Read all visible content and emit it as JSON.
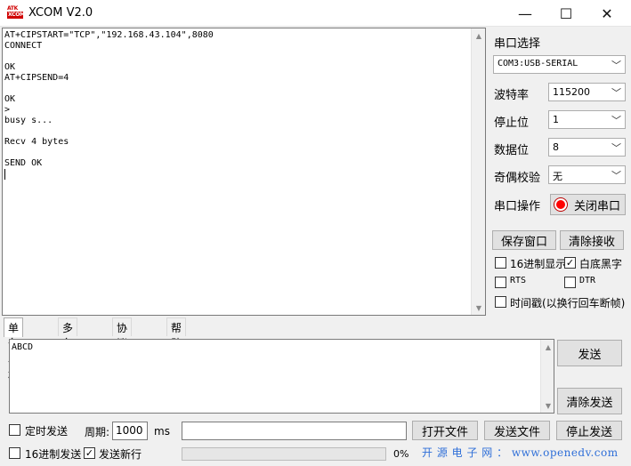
{
  "window": {
    "logo_top": "ATK",
    "logo_bottom": "XCOM",
    "title": "XCOM V2.0",
    "minimize": "—",
    "maximize": "☐",
    "close": "✕"
  },
  "receive": {
    "lines": [
      "AT+CIPSTART=\"TCP\",\"192.168.43.104\",8080",
      "CONNECT",
      "",
      "OK",
      "AT+CIPSEND=4",
      "",
      "OK",
      ">",
      "busy s...",
      "",
      "Recv 4 bytes",
      "",
      "SEND OK"
    ]
  },
  "serial": {
    "port_label": "串口选择",
    "port_value": "COM3:USB-SERIAL",
    "baud_label": "波特率",
    "baud_value": "115200",
    "stop_label": "停止位",
    "stop_value": "1",
    "data_label": "数据位",
    "data_value": "8",
    "parity_label": "奇偶校验",
    "parity_value": "无",
    "op_label": "串口操作",
    "close_port_button": "关闭串口",
    "port_open_color": "#ff0000"
  },
  "recv_options": {
    "save_window": "保存窗口",
    "clear_receive": "清除接收",
    "hex_display": "16进制显示",
    "hex_display_checked": false,
    "white_bg_black_text": "白底黑字",
    "white_bg_checked": true,
    "rts": "RTS",
    "rts_checked": false,
    "dtr": "DTR",
    "dtr_checked": false,
    "timestamp": "时间戳(以换行回车断帧)",
    "timestamp_checked": false
  },
  "tabs": [
    "单条发送",
    "多条发送",
    "协议传输",
    "帮助"
  ],
  "send": {
    "text": "ABCD",
    "send_button": "发送",
    "clear_send_button": "清除发送",
    "timed_send": "定时发送",
    "timed_send_checked": false,
    "period_label": "周期:",
    "period_value": "1000",
    "period_unit": "ms",
    "hex_send": "16进制发送",
    "hex_send_checked": false,
    "send_newline": "发送新行",
    "send_newline_checked": true,
    "open_file": "打开文件",
    "send_file": "发送文件",
    "stop_send": "停止发送",
    "progress_percent": "0%",
    "progress_value": 0
  },
  "watermark": "开 源 电 子 网 ： www.openedv.com"
}
